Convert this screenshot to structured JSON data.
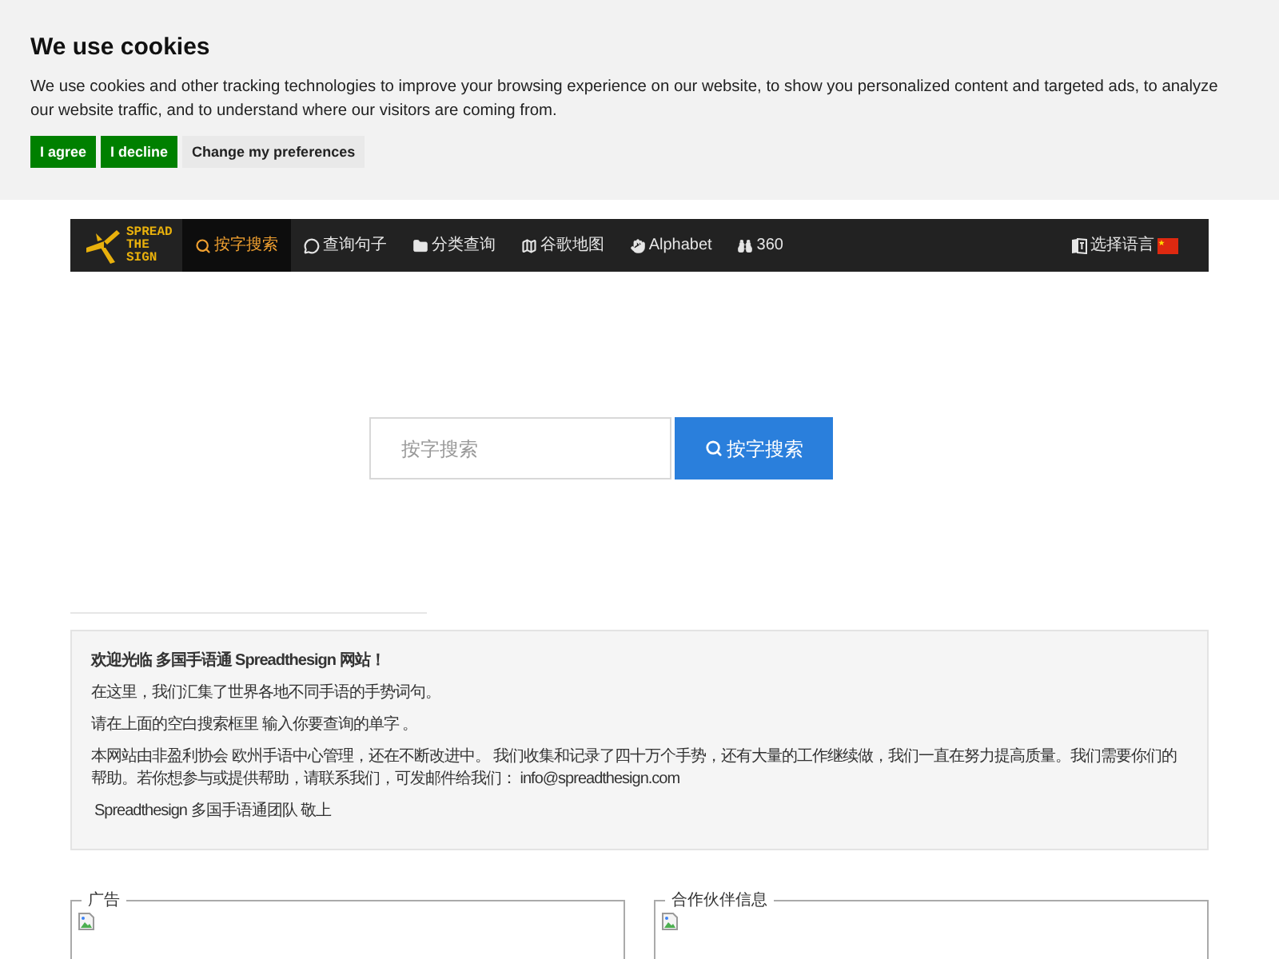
{
  "cookie_banner": {
    "title": "We use cookies",
    "text": "We use cookies and other tracking technologies to improve your browsing experience on our website, to show you personalized content and targeted ads, to analyze our website traffic, and to understand where our visitors are coming from.",
    "buttons": [
      {
        "label": "I agree",
        "kind": "primary"
      },
      {
        "label": "I decline",
        "kind": "primary"
      },
      {
        "label": "Change my preferences",
        "kind": "secondary"
      }
    ]
  },
  "navbar": {
    "logo": [
      "SPREAD",
      "THE",
      "SIGN"
    ],
    "items": [
      {
        "label": "按字搜索",
        "selected": true
      },
      {
        "label": "查询句子",
        "selected": false
      },
      {
        "label": "分类查询",
        "selected": false
      },
      {
        "label": "谷歌地图",
        "selected": false
      },
      {
        "label": "Alphabet",
        "selected": false
      },
      {
        "label": "360",
        "selected": false
      }
    ],
    "language": {
      "label": "选择语言"
    }
  },
  "search": {
    "placeholder": "按字搜索",
    "button": "按字搜索"
  },
  "welcome": {
    "title": "欢迎光临 多国手语通 Spreadthesign 网站！",
    "paragraphs": [
      "在这里，我们汇集了世界各地不同手语的手势词句。",
      "请在上面的空白搜索框里 输入你要查询的单字 。",
      "本网站由非盈利协会 欧州手语中心管理，还在不断改进中。 我们收集和记录了四十万个手势，还有大量的工作继续做，我们一直在努力提高质量。我们需要你们的帮助。若你想参与或提供帮助，请联系我们，可发邮件给我们： info@spreadthesign.com"
    ],
    "signature": "Spreadthesign 多国手语通团队 敬上"
  },
  "panels": [
    {
      "legend": "广告"
    },
    {
      "legend": "合作伙伴信息"
    }
  ]
}
